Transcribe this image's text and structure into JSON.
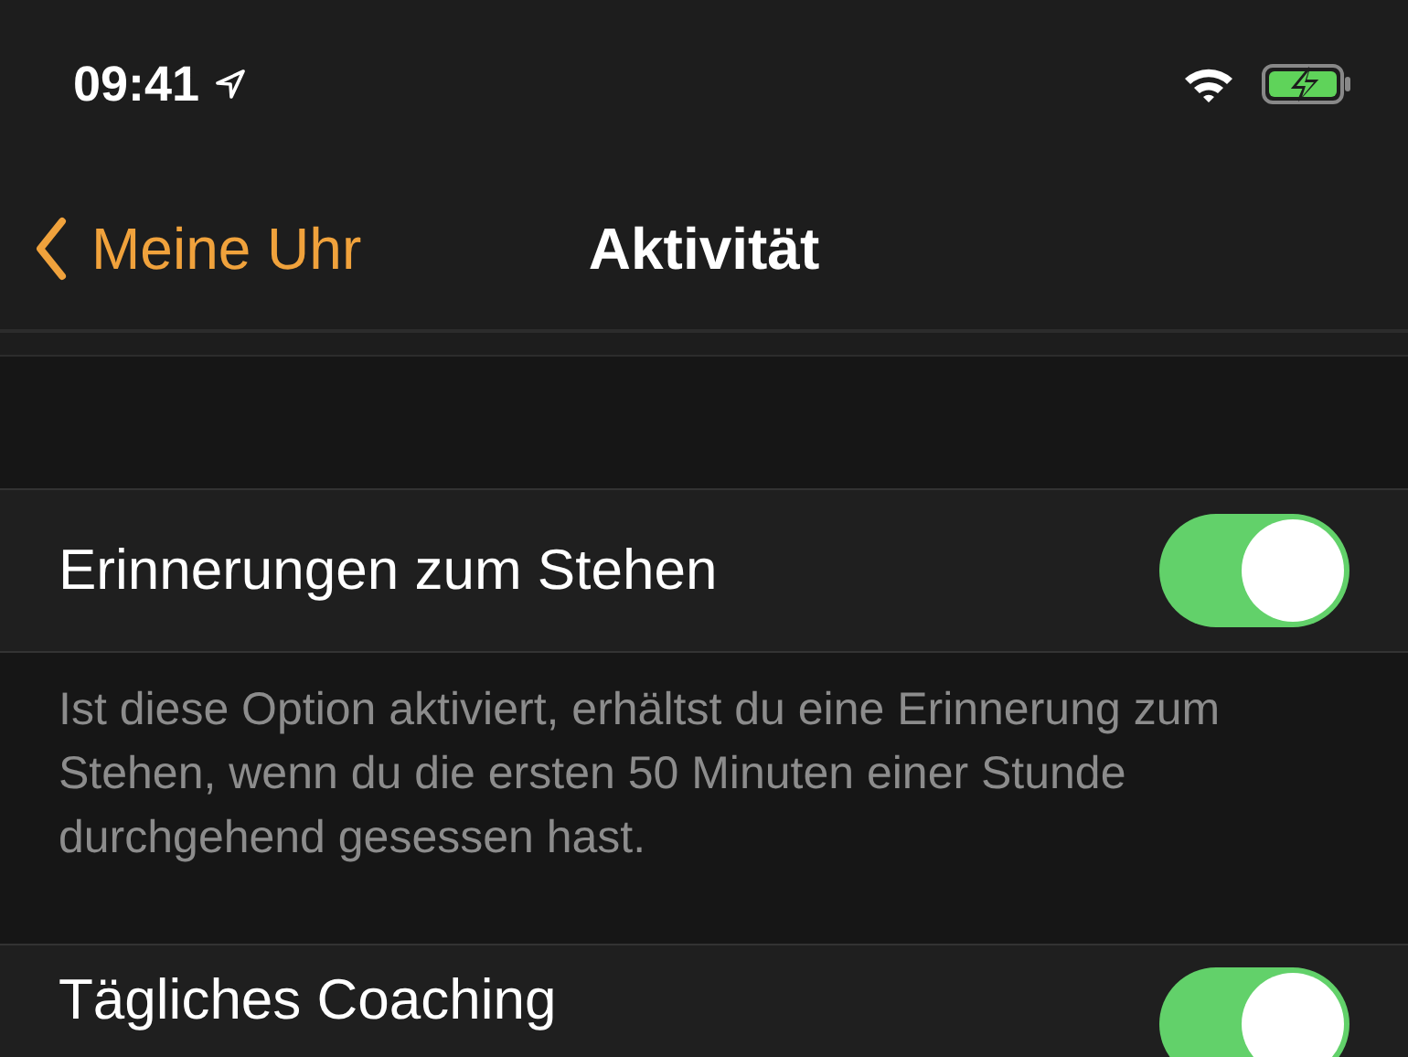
{
  "status_bar": {
    "time": "09:41"
  },
  "nav": {
    "back": "Meine Uhr",
    "title": "Aktivität"
  },
  "settings": [
    {
      "label": "Erinnerungen zum Stehen",
      "on": true,
      "footer": "Ist diese Option aktiviert, erhältst du eine Erinnerung zum Stehen, wenn du die ersten 50 Minuten einer Stunde durchgehend gesessen hast."
    },
    {
      "label": "Tägliches Coaching",
      "on": true
    }
  ]
}
